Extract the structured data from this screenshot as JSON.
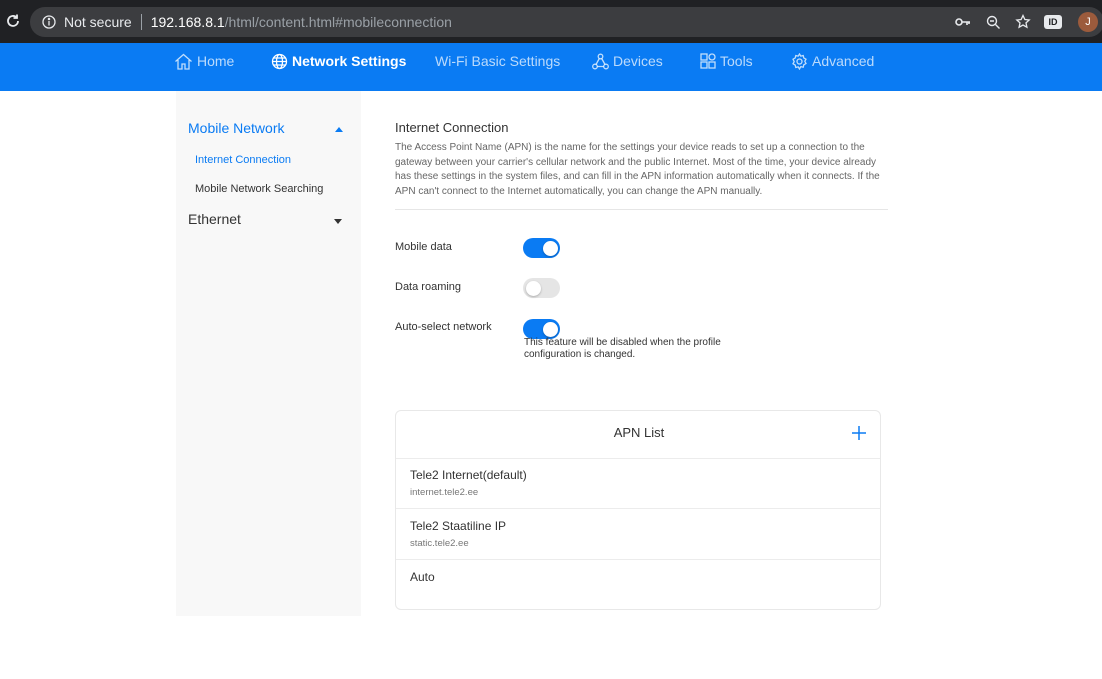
{
  "browser": {
    "security_label": "Not secure",
    "url_host": "192.168.8.1",
    "url_path": "/html/content.html#mobileconnection",
    "ext_badge": "ID",
    "avatar_letter": "J"
  },
  "nav": {
    "items": [
      {
        "label": "Home",
        "icon": "home-icon"
      },
      {
        "label": "Network Settings",
        "icon": "globe-icon",
        "active": true
      },
      {
        "label": "Wi-Fi Basic Settings",
        "icon": ""
      },
      {
        "label": "Devices",
        "icon": "devices-icon"
      },
      {
        "label": "Tools",
        "icon": "tools-icon"
      },
      {
        "label": "Advanced",
        "icon": "gear-icon"
      }
    ]
  },
  "sidebar": {
    "groups": [
      {
        "label": "Mobile Network",
        "expanded": true,
        "items": [
          {
            "label": "Internet Connection",
            "active": true
          },
          {
            "label": "Mobile Network Searching",
            "active": false
          }
        ]
      },
      {
        "label": "Ethernet",
        "expanded": false,
        "items": []
      }
    ]
  },
  "main": {
    "title": "Internet Connection",
    "description": "The Access Point Name (APN) is the name for the settings your device reads to set up a connection to the gateway between your carrier's cellular network and the public Internet. Most of the time, your device already has these settings in the system files, and can fill in the APN information automatically when it connects. If the APN can't connect to the Internet automatically, you can change the APN manually.",
    "settings": [
      {
        "label": "Mobile data",
        "enabled": true
      },
      {
        "label": "Data roaming",
        "enabled": false
      },
      {
        "label": "Auto-select network",
        "enabled": true
      }
    ],
    "auto_select_hint": "This feature will be disabled when the profile configuration is changed."
  },
  "apn": {
    "title": "APN List",
    "items": [
      {
        "name": "Tele2 Internet(default)",
        "apn": "internet.tele2.ee"
      },
      {
        "name": "Tele2 Staatiline IP",
        "apn": "static.tele2.ee"
      },
      {
        "name": "Auto",
        "apn": ""
      }
    ]
  },
  "colors": {
    "accent": "#0a7bf3",
    "browser_bg": "#202124",
    "toggle_off": "#e5e5e5"
  }
}
